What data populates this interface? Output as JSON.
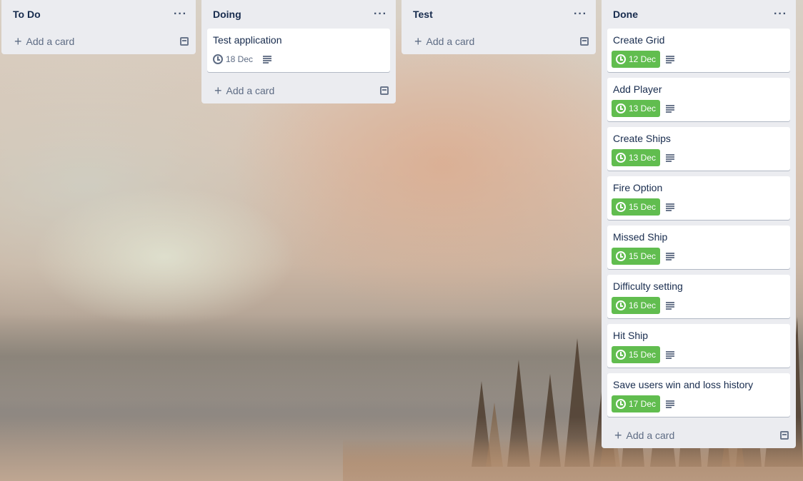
{
  "lists": [
    {
      "title": "To Do",
      "menu_icon": "more-horizontal-icon",
      "cards": [],
      "add_label": "Add a card"
    },
    {
      "title": "Doing",
      "menu_icon": "more-horizontal-icon",
      "cards": [
        {
          "title": "Test application",
          "due": "18 Dec",
          "complete": false
        }
      ],
      "add_label": "Add a card"
    },
    {
      "title": "Test",
      "menu_icon": "more-horizontal-icon",
      "cards": [],
      "add_label": "Add a card"
    },
    {
      "title": "Done",
      "menu_icon": "more-horizontal-icon",
      "cards": [
        {
          "title": "Create Grid",
          "due": "12 Dec",
          "complete": true
        },
        {
          "title": "Add Player",
          "due": "13 Dec",
          "complete": true
        },
        {
          "title": "Create Ships",
          "due": "13 Dec",
          "complete": true
        },
        {
          "title": "Fire Option",
          "due": "15 Dec",
          "complete": true
        },
        {
          "title": "Missed Ship",
          "due": "15 Dec",
          "complete": true
        },
        {
          "title": "Difficulty setting",
          "due": "16 Dec",
          "complete": true
        },
        {
          "title": "Hit Ship",
          "due": "15 Dec",
          "complete": true
        },
        {
          "title": "Save users win and loss history",
          "due": "17 Dec",
          "complete": true
        }
      ],
      "add_label": "Add a card"
    }
  ],
  "colors": {
    "list_bg": "#ebecf0",
    "due_complete": "#61bd4f",
    "text": "#172b4d",
    "subtle_text": "#5e6c84"
  }
}
